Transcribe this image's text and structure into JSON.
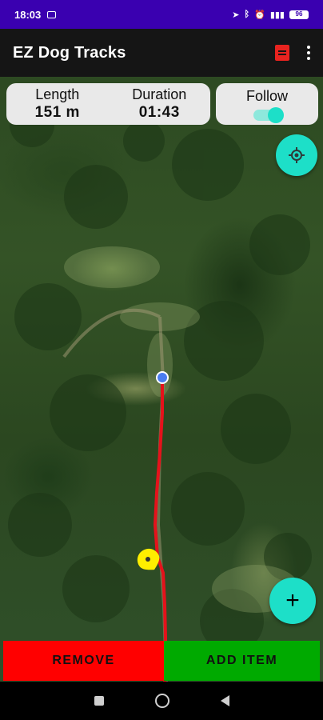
{
  "status_bar": {
    "time": "18:03",
    "battery": "96"
  },
  "app_bar": {
    "title": "EZ Dog Tracks",
    "save_icon": "save-icon",
    "more_icon": "more-vert-icon"
  },
  "track_info": {
    "length_label": "Length",
    "length_value": "151 m",
    "duration_label": "Duration",
    "duration_value": "01:43"
  },
  "follow": {
    "label": "Follow",
    "enabled": true
  },
  "map": {
    "track_color": "#e5121b",
    "location_dot_color": "#4a7cf0",
    "marker_color": "#ffee00"
  },
  "fab": {
    "locate_icon": "my-location-icon",
    "add_label": "+"
  },
  "actions": {
    "remove_label": "REMOVE",
    "add_item_label": "ADD ITEM",
    "remove_color": "#ff0000",
    "add_color": "#00aa00"
  },
  "nav_bar": {
    "recents_icon": "recents-icon",
    "home_icon": "home-icon",
    "back_icon": "back-icon"
  }
}
